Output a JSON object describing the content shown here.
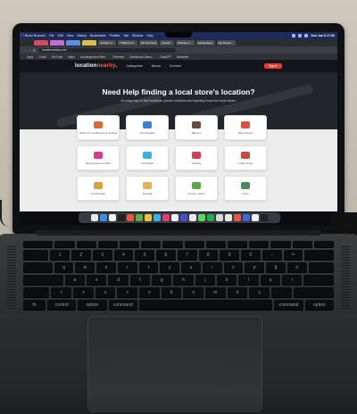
{
  "menubar": {
    "items": [
      "Brave Browser",
      "File",
      "Edit",
      "View",
      "History",
      "Bookmarks",
      "Profiles",
      "Tab",
      "Window",
      "Help"
    ],
    "clock": "Sun Jun 8 17:53"
  },
  "browser": {
    "tabs": [
      {
        "label": "",
        "color": "#d24b5c"
      },
      {
        "label": "",
        "color": "#c46bd9"
      },
      {
        "label": "",
        "color": "#5c8ee8"
      },
      {
        "label": "",
        "color": "#d6c04a"
      },
      {
        "label": "website fo...",
        "color": "#4a4d55"
      },
      {
        "label": "TheBest Fo...",
        "color": "#4a4d55"
      },
      {
        "label": "PH Rockwell",
        "color": "#4a4d55"
      },
      {
        "label": "Upload",
        "color": "#4a4d55"
      },
      {
        "label": "Website A…",
        "color": "#4a4d55"
      },
      {
        "label": "webdesigner",
        "color": "#4a4d55"
      },
      {
        "label": "Top Ranke…",
        "color": "#4a4d55"
      }
    ],
    "url": "locationnearby.com",
    "bookmarks": [
      "Apps",
      "Gmail",
      "YouTube",
      "Maps",
      "Uncategorised Web...",
      "Pinterest",
      "Dashboard Ubers...",
      "ChatGPT",
      "Websites"
    ]
  },
  "site": {
    "logo_main": "location",
    "logo_accent": "nearby",
    "logo_suffix": ".",
    "nav": [
      "Categories",
      "About",
      "Contact"
    ],
    "signin_label": "Sign in",
    "hero_title": "Need Help finding a local store's location?",
    "hero_subtitle": "An easy way to find locations, phone numbers and opening hours for local stores.",
    "categories": [
      {
        "label": "HVAC Air Conditioning & Heating",
        "color": "#d86a3b"
      },
      {
        "label": "Auto Repairs",
        "color": "#3b7fd8"
      },
      {
        "label": "Barbers",
        "color": "#6a4a3a"
      },
      {
        "label": "Bars & Pubs",
        "color": "#d8553b"
      },
      {
        "label": "Beauty Salons & SPA",
        "color": "#d83b8a"
      },
      {
        "label": "Car Repair",
        "color": "#3bb0d8"
      },
      {
        "label": "Clothing",
        "color": "#d83b4f"
      },
      {
        "label": "Coffee shops",
        "color": "#c94a3a"
      },
      {
        "label": "Construction",
        "color": "#d8a13b"
      },
      {
        "label": "Dentists",
        "color": "#e0b25a"
      },
      {
        "label": "Grocery stores",
        "color": "#5aa84a"
      },
      {
        "label": "Gyms",
        "color": "#4a8a5a"
      }
    ]
  },
  "dock": {
    "apps": [
      "#e8e8e8",
      "#3b8ee8",
      "#f2f2f2",
      "#222",
      "#e85a3b",
      "#5ab04a",
      "#f0c03b",
      "#3bb0e8",
      "#e83b6a",
      "#f2f2f2",
      "#4a4ad8",
      "#e8e8e8",
      "#5ad85a",
      "#2aa84a",
      "#d8d8d8",
      "#e8e8e8",
      "#e85a3b",
      "#3b6ad8",
      "#f0f0f0",
      "#222"
    ]
  },
  "keyboard": {
    "row1": [
      "1",
      "2",
      "3",
      "4",
      "5",
      "6",
      "7",
      "8",
      "9",
      "0",
      "-",
      "="
    ],
    "row2": [
      "q",
      "w",
      "e",
      "r",
      "t",
      "y",
      "u",
      "ı",
      "o",
      "p",
      "ğ",
      "ü"
    ],
    "row3": [
      "a",
      "s",
      "d",
      "f",
      "g",
      "h",
      "j",
      "k",
      "l",
      "ş",
      "i"
    ],
    "row4": [
      "<",
      "z",
      "x",
      "c",
      "v",
      "b",
      "n",
      "m",
      "ö",
      "ç",
      "."
    ],
    "row5": [
      "fn",
      "control",
      "option",
      "command",
      "",
      "command",
      "option"
    ]
  }
}
